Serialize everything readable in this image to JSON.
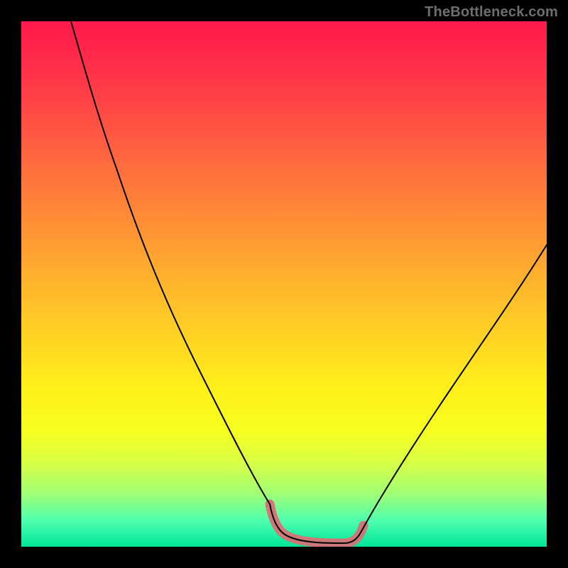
{
  "watermark": "TheBottleneck.com",
  "colors": {
    "page_bg": "#000000",
    "watermark": "#6e6e6e",
    "curve": "#000000",
    "highlight": "#d67276",
    "gradient_top": "#ff1a4b",
    "gradient_mid": "#ffd324",
    "gradient_bottom": "#00e59a"
  },
  "chart_data": {
    "type": "line",
    "title": "",
    "xlabel": "",
    "ylabel": "",
    "xlim": [
      0,
      100
    ],
    "ylim": [
      0,
      100
    ],
    "x": [
      10,
      15,
      20,
      25,
      30,
      35,
      40,
      45,
      48,
      50,
      52,
      55,
      60,
      65,
      70,
      75,
      80,
      85,
      90,
      95,
      100
    ],
    "values": [
      100,
      85,
      72,
      60,
      49,
      39,
      29,
      17,
      8,
      2,
      0,
      0,
      0,
      2,
      6,
      13,
      22,
      32,
      42,
      51,
      58
    ],
    "highlight_range_x": [
      47,
      62
    ],
    "grid": false,
    "legend": false
  }
}
